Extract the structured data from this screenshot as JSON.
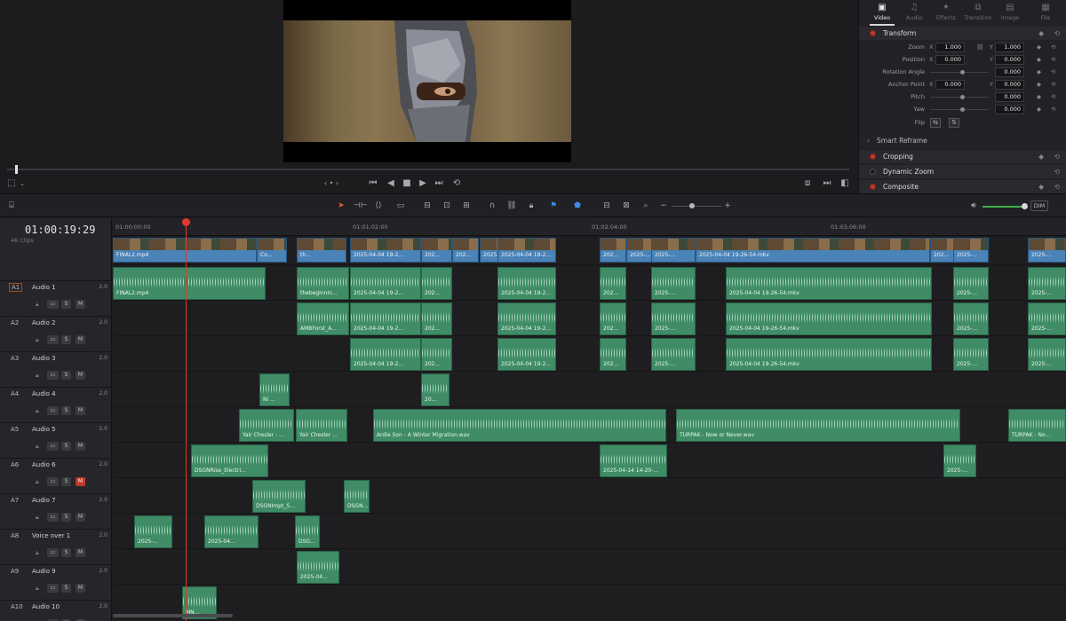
{
  "viewer": {
    "nav_label": "‹ • ›"
  },
  "inspector": {
    "tabs": [
      {
        "label": "Video",
        "icon": "video-icon",
        "glyph": "▣"
      },
      {
        "label": "Audio",
        "icon": "audio-icon",
        "glyph": "♫"
      },
      {
        "label": "Effects",
        "icon": "effects-icon",
        "glyph": "✦"
      },
      {
        "label": "Transition",
        "icon": "transition-icon",
        "glyph": "⧉"
      },
      {
        "label": "Image",
        "icon": "image-icon",
        "glyph": "▤"
      },
      {
        "label": "File",
        "icon": "file-icon",
        "glyph": "▦"
      }
    ],
    "transform": {
      "title": "Transform",
      "zoom": {
        "label": "Zoom",
        "x": "1.000",
        "y": "1.000"
      },
      "position": {
        "label": "Position",
        "x": "0.000",
        "y": "0.000"
      },
      "rotation": {
        "label": "Rotation Angle",
        "value": "0.000"
      },
      "anchor": {
        "label": "Anchor Point",
        "x": "0.000",
        "y": "0.000"
      },
      "pitch": {
        "label": "Pitch",
        "value": "0.000"
      },
      "yaw": {
        "label": "Yaw",
        "value": "0.000"
      },
      "flip": {
        "label": "Flip"
      },
      "x_label": "X",
      "y_label": "Y"
    },
    "smart_reframe": "Smart Reframe",
    "cropping": "Cropping",
    "dynamic_zoom": "Dynamic Zoom",
    "composite": "Composite"
  },
  "timeline": {
    "timecode": "01:00:19:29",
    "clips_count": "46 Clips",
    "dim_label": "DIM",
    "ruler": [
      "01:00:00:00",
      "01:01:02:00",
      "01:02:04:00",
      "01:03:06:00"
    ],
    "tracks": [
      {
        "id": "A1",
        "name": "Audio 1",
        "ch": "2.0",
        "mute": false,
        "selected": true
      },
      {
        "id": "A2",
        "name": "Audio 2",
        "ch": "2.0",
        "mute": false
      },
      {
        "id": "A3",
        "name": "Audio 3",
        "ch": "2.0",
        "mute": false
      },
      {
        "id": "A4",
        "name": "Audio 4",
        "ch": "2.0",
        "mute": false
      },
      {
        "id": "A5",
        "name": "Audio 5",
        "ch": "2.0",
        "mute": false
      },
      {
        "id": "A6",
        "name": "Audio 6",
        "ch": "2.0",
        "mute": true
      },
      {
        "id": "A7",
        "name": "Audio 7",
        "ch": "2.0",
        "mute": false
      },
      {
        "id": "A8",
        "name": "Voice over 1",
        "ch": "2.0",
        "mute": false
      },
      {
        "id": "A9",
        "name": "Audio 9",
        "ch": "2.0",
        "mute": false
      },
      {
        "id": "A10",
        "name": "Audio 10",
        "ch": "2.0",
        "mute": false
      }
    ],
    "video_clips": [
      "FINAL2.mp4",
      "Co...",
      "th...",
      "2025-04-04 19-2...",
      "202...",
      "202...",
      "2025-...",
      "2025-04-04 19-2...",
      "202...",
      "2025-...",
      "2025-...",
      "2025-04-04 19-26-54.mkv",
      "202...",
      "2025-...",
      "2025-..."
    ],
    "audio_clips": {
      "a1": [
        "FINAL2.mp4",
        "thebeginnin...",
        "2025-04-04 19-2...",
        "202...",
        "2025-04-04 19-2...",
        "202...",
        "2025-...",
        "2025-04-04 19-26-54.mkv",
        "2025-...",
        "2025-..."
      ],
      "a2": [
        "AMBForst_A...",
        "2025-04-04 19-2...",
        "202...",
        "2025-04-04 19-2...",
        "202...",
        "2025-...",
        "2025-04-04 19-26-54.mkv",
        "2025-...",
        "2025-..."
      ],
      "a3": [
        "2025-04-04 19-2...",
        "202...",
        "2025-04-04 19-2...",
        "202...",
        "2025-...",
        "2025-04-04 19-26-54.mkv",
        "2025-...",
        "2025-..."
      ],
      "a4": [
        "Ni ...",
        "20..."
      ],
      "a5": [
        "Yair Chesler - ...",
        "Yair Chesler ...",
        "Ardie Son - A Winter Migration.wav",
        "TURPAK - Now or Never.wav",
        "TURPAK - No..."
      ],
      "a6": [
        "DSGNRise_Electri...",
        "2025-04-14 14-20-...",
        "2025-..."
      ],
      "a7": [
        "DSGNImpt_S...",
        "DSGN..."
      ],
      "a8": [
        "2025-...",
        "2025-04...",
        "DSG..."
      ],
      "a9": [
        "2025-04..."
      ],
      "a10": [
        "MN..."
      ]
    }
  }
}
